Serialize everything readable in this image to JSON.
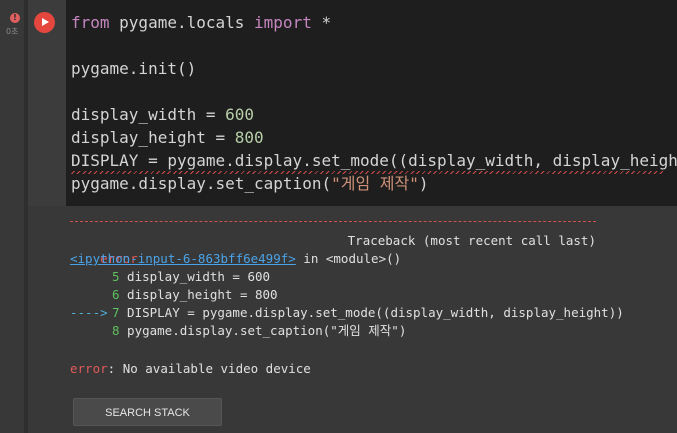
{
  "cell": {
    "status_icon": "!",
    "exec_time": "0초",
    "run_icon": "play-icon"
  },
  "code": {
    "line1": {
      "kw1": "from",
      "mod": " pygame.locals ",
      "kw2": "import",
      "rest": " *"
    },
    "line2": "pygame.init()",
    "line3": {
      "lhs": "display_width = ",
      "num": "600"
    },
    "line4": {
      "lhs": "display_height = ",
      "num": "800"
    },
    "line5": "DISPLAY = pygame.display.set_mode((display_width, display_height))",
    "line6": {
      "pre": "pygame.display.set_caption(",
      "str": "\"게임 제작\"",
      "post": ")"
    }
  },
  "output": {
    "error_label": "error",
    "traceback_header": "Traceback (most recent call last)",
    "input_link": "<ipython-input-6-863bff6e499f>",
    "in_module": " in <module>()",
    "tb_lines": [
      {
        "arrow": "",
        "num": "5",
        "text": " display_width = 600"
      },
      {
        "arrow": "",
        "num": "6",
        "text": " display_height = 800"
      },
      {
        "arrow": "---->",
        "num": "7",
        "text": " DISPLAY = pygame.display.set_mode((display_width, display_height))"
      },
      {
        "arrow": "",
        "num": "8",
        "text": " pygame.display.set_caption(\"게임 제작\")"
      }
    ],
    "final_error": "error",
    "final_msg": ": No available video device"
  },
  "search_button_label": "SEARCH STACK OVERFLOW"
}
